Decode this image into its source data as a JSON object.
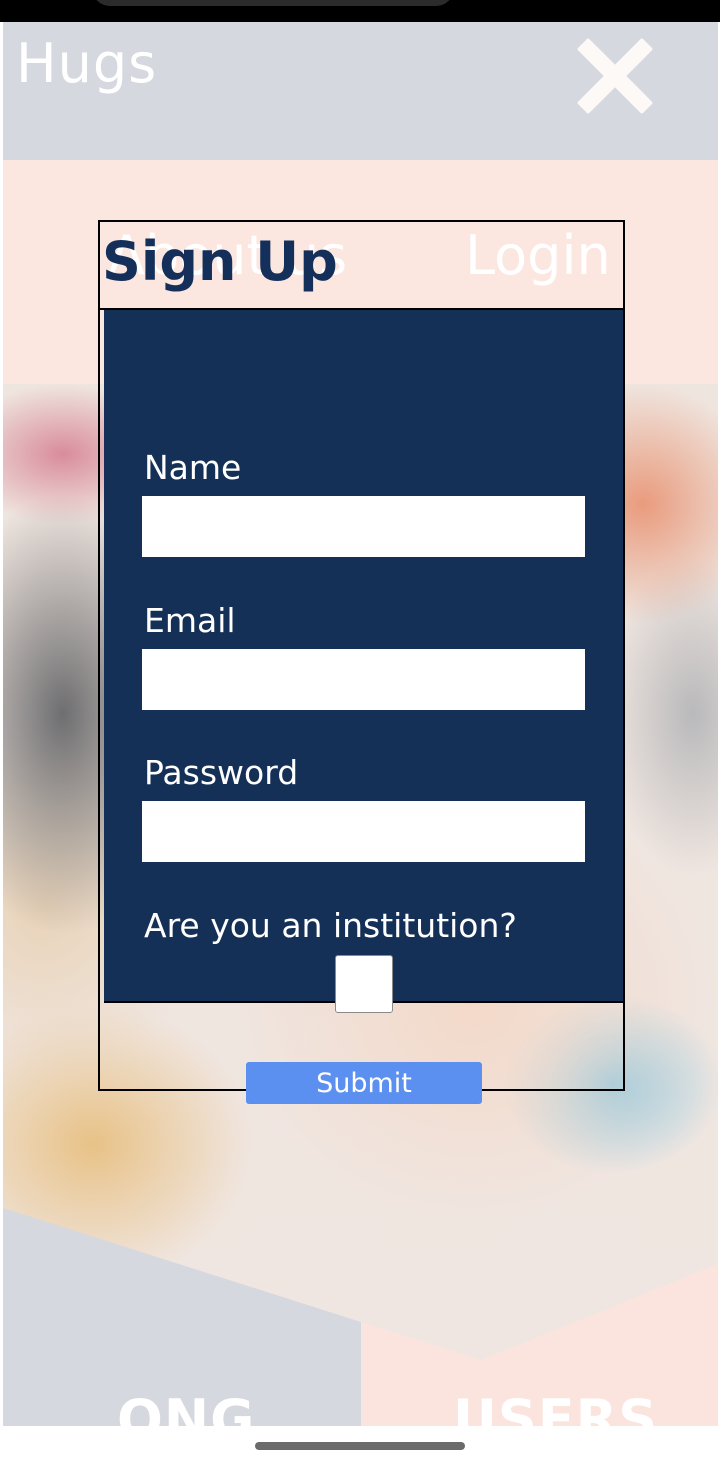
{
  "header": {
    "brand": "Hugs",
    "close_icon": "close-icon"
  },
  "nav": {
    "about": "About us",
    "login": "Login"
  },
  "sections": {
    "left_label": "ONG",
    "right_label": "USERS"
  },
  "signup": {
    "title": "Sign Up",
    "name_label": "Name",
    "name_value": "",
    "email_label": "Email",
    "email_value": "",
    "password_label": "Password",
    "password_value": "",
    "institution_label": "Are you an institution?",
    "institution_checked": false,
    "submit_label": "Submit"
  },
  "colors": {
    "header_bg": "#d5d8de",
    "nav_bg": "#fce6e0",
    "form_bg": "#153057",
    "title": "#14305a",
    "submit": "#5b8ff0"
  }
}
